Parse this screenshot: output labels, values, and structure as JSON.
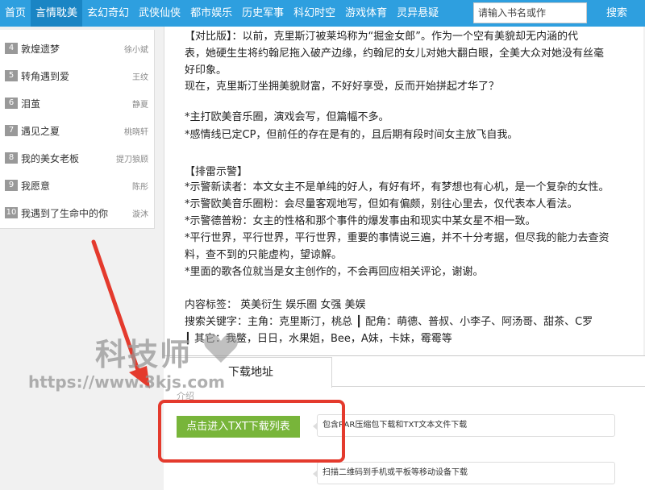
{
  "nav": {
    "items": [
      "首页",
      "言情耽美",
      "玄幻奇幻",
      "武侠仙侠",
      "都市娱乐",
      "历史军事",
      "科幻时空",
      "游戏体育",
      "灵异悬疑"
    ],
    "active_index": 1,
    "search_placeholder": "请输入书名或作",
    "search_label": "搜索",
    "color": "#2e9fdf"
  },
  "rank_list": [
    {
      "num": "4",
      "title": "敦煌遗梦",
      "author": "徐小斌"
    },
    {
      "num": "5",
      "title": "转角遇到爱",
      "author": "王纹"
    },
    {
      "num": "6",
      "title": "泪茧",
      "author": "静夏"
    },
    {
      "num": "7",
      "title": "遇见之夏",
      "author": "桃晓轩"
    },
    {
      "num": "8",
      "title": "我的美女老板",
      "author": "提刀狼顾"
    },
    {
      "num": "9",
      "title": "我愿意",
      "author": "陈彤"
    },
    {
      "num": "10",
      "title": "我遇到了生命中的你",
      "author": "漩沐"
    }
  ],
  "content": {
    "lines": [
      "【对比版】：以前，克里斯汀被莱坞称为“掘金女郎”。作为一个空有美貌却无内涵的代",
      "表，她硬生生将约翰尼拖入破产边缘，约翰尼的女儿对她大翻白眼，全美大众对她没有丝毫",
      "好印象。",
      "现在，克里斯汀坐拥美貌财富，不好好享受，反而开始拼起才华了？",
      "",
      "*主打欧美音乐圈，演戏会写，但篇幅不多。",
      "*感情线已定CP，但前任的存在是有的，且后期有段时间女主放飞自我。",
      "",
      "【排雷示警】",
      "*示警新读者：本文女主不是单纯的好人，有好有坏，有梦想也有心机，是一个复杂的女性。",
      "*示警欧美音乐圈粉：会尽量客观地写，但如有偏颇，别往心里去，仅代表本人看法。",
      "*示警德普粉：女主的性格和那个事件的爆发事由和现实中某女星不相一致。",
      "*平行世界，平行世界，平行世界，重要的事情说三遍，并不十分考据，但尽我的能力去查资",
      "料，查不到的只能虚构，望谅解。",
      "*里面的歌各位就当是女主创作的，不会再回应相关评论，谢谢。",
      "",
      "内容标签：  英美衍生 娱乐圈 女强 美娱",
      "搜索关键字：主角：克里斯汀，桃总 ┃ 配角：萌德、普叔、小李子、阿汤哥、甜茶、C罗",
      "┃ 其它：我鳖，日日，水果姐，Bee，A妹，卡妹，霉霉等"
    ]
  },
  "download": {
    "tab_label": "下载地址",
    "small_label": "介绍",
    "button_label": "点击进入TXT下载列表",
    "info_1": "包含RAR压缩包下载和TXT文本文件下载",
    "info_2": "扫描二维码到手机或平板等移动设备下载"
  },
  "watermark": {
    "main": "科技师",
    "url": "https://www.3kjs.com"
  },
  "colors": {
    "annotation_red": "#e43a2d",
    "button_green": "#78b53a"
  }
}
